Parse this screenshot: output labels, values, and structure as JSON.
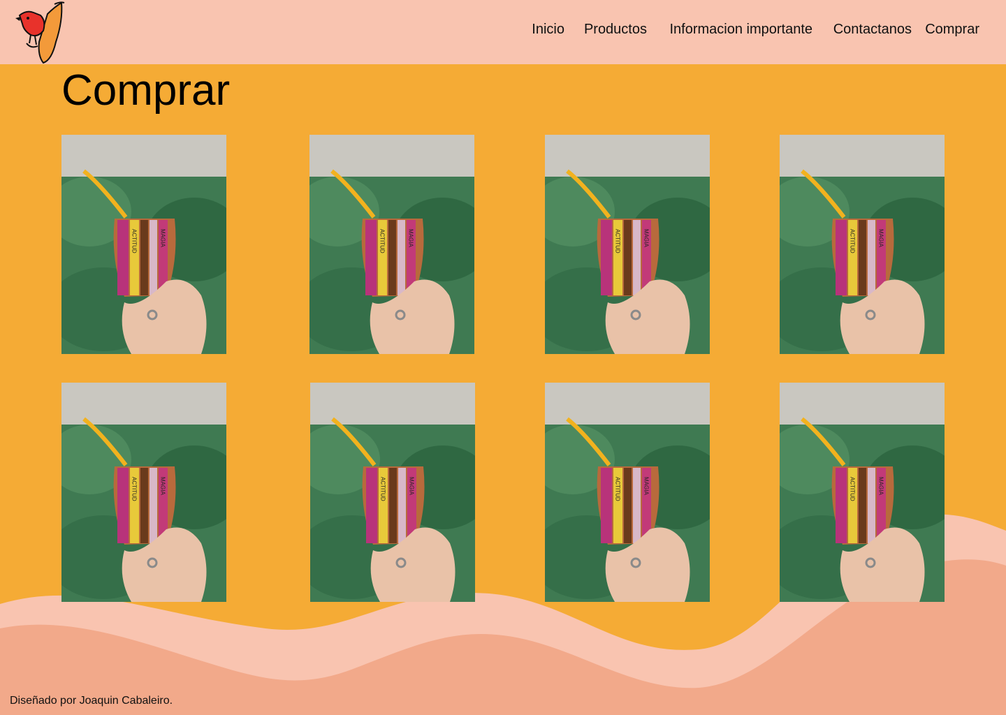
{
  "header": {
    "logo_icon": "bird-logo-icon",
    "nav": [
      {
        "label": "Inicio"
      },
      {
        "label": "Productos"
      },
      {
        "label": "Informacion importante"
      },
      {
        "label": "Contactanos"
      },
      {
        "label": "Comprar"
      }
    ]
  },
  "main": {
    "title": "Comprar",
    "products": [
      {
        "icon": "mate-cup-photo",
        "text_left": "ACTITUD",
        "text_right": "MAGIA"
      },
      {
        "icon": "mate-cup-photo",
        "text_left": "ACTITUD",
        "text_right": "MAGIA"
      },
      {
        "icon": "mate-cup-photo",
        "text_left": "ACTITUD",
        "text_right": "MAGIA"
      },
      {
        "icon": "mate-cup-photo",
        "text_left": "ACTITUD",
        "text_right": "MAGIA"
      },
      {
        "icon": "mate-cup-photo",
        "text_left": "ACTITUD",
        "text_right": "MAGIA"
      },
      {
        "icon": "mate-cup-photo",
        "text_left": "ACTITUD",
        "text_right": "MAGIA"
      },
      {
        "icon": "mate-cup-photo",
        "text_left": "ACTITUD",
        "text_right": "MAGIA"
      },
      {
        "icon": "mate-cup-photo",
        "text_left": "ACTITUD",
        "text_right": "MAGIA"
      }
    ]
  },
  "footer": {
    "credit": "Diseñado por Joaquin Cabaleiro."
  },
  "colors": {
    "header_bg": "#f9c4b0",
    "page_bg": "#f5ab35",
    "wave_light": "#f9c4b0",
    "wave_dark": "#f2a98a"
  }
}
